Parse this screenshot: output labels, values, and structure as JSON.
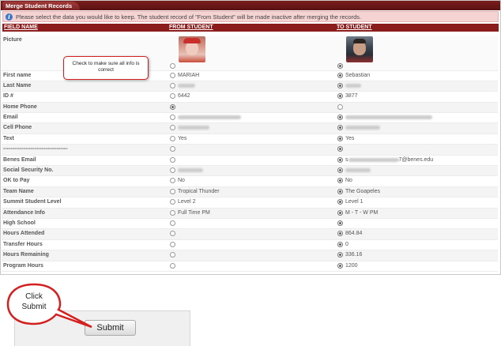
{
  "tab_title": "Merge Student Records",
  "notice": "Please select the data you would like to keep. The student record of \"From Student\" will be made inactive after merging the records.",
  "headers": {
    "field": "FIELD NAME",
    "from": "FROM STUDENT",
    "to": "TO STUDENT"
  },
  "rows": [
    {
      "label": "Picture",
      "from": "",
      "to": "",
      "to_selected": true
    },
    {
      "label": "First name",
      "from": "MARIAH",
      "to": "Sebastian",
      "to_selected": true
    },
    {
      "label": "Last Name",
      "from": "",
      "to": "",
      "from_blur": 22,
      "to_blur": 20,
      "to_selected": true
    },
    {
      "label": "ID #",
      "from": "6442",
      "to": "3877",
      "to_selected": true
    },
    {
      "label": "Home Phone",
      "from": "",
      "to": "",
      "to_selected": false
    },
    {
      "label": "Email",
      "from": "",
      "to": "",
      "from_blur": 80,
      "to_blur": 110,
      "to_selected": true
    },
    {
      "label": "Cell Phone",
      "from": "",
      "to": "",
      "from_blur": 40,
      "to_blur": 44,
      "to_selected": true
    },
    {
      "label": "Text",
      "from": "Yes",
      "to": "Yes",
      "to_selected": true
    },
    {
      "label": "-----------------------------------",
      "from": "",
      "to": "",
      "to_selected": true
    },
    {
      "label": "Benes Email",
      "from": "",
      "to": "7@benes.edu",
      "to_prefix": "s",
      "to_blur": 64,
      "to_selected": true
    },
    {
      "label": "Social Security No.",
      "from": "",
      "to": "",
      "from_blur": 32,
      "to_blur": 32,
      "to_selected": true
    },
    {
      "label": "OK to Pay",
      "from": "No",
      "to": "No",
      "to_selected": true
    },
    {
      "label": "Team Name",
      "from": "Tropical Thunder",
      "to": "The Goapeles",
      "to_selected": true
    },
    {
      "label": "Summit Student Level",
      "from": "Level 2",
      "to": "Level 1",
      "to_selected": true
    },
    {
      "label": "Attendance Info",
      "from": "Full Time PM",
      "to": "M - T - W PM",
      "to_selected": true
    },
    {
      "label": "High School",
      "from": "",
      "to": "",
      "to_selected": true
    },
    {
      "label": "Hours Attended",
      "from": "",
      "to": "864.84",
      "to_selected": true
    },
    {
      "label": "Transfer Hours",
      "from": "",
      "to": "0",
      "to_selected": true
    },
    {
      "label": "Hours Remaining",
      "from": "",
      "to": "336.16",
      "to_selected": true
    },
    {
      "label": "Program Hours",
      "from": "",
      "to": "1200",
      "to_selected": true
    }
  ],
  "callout_check": {
    "line1": "Check to make sure all info is",
    "line2": "correct"
  },
  "callout_submit": {
    "line1": "Click",
    "line2": "Submit"
  },
  "submit_label": "Submit",
  "colors": {
    "header": "#8b1c1c",
    "notice_bg": "#f5d3d3",
    "callout_border": "#d32020"
  }
}
